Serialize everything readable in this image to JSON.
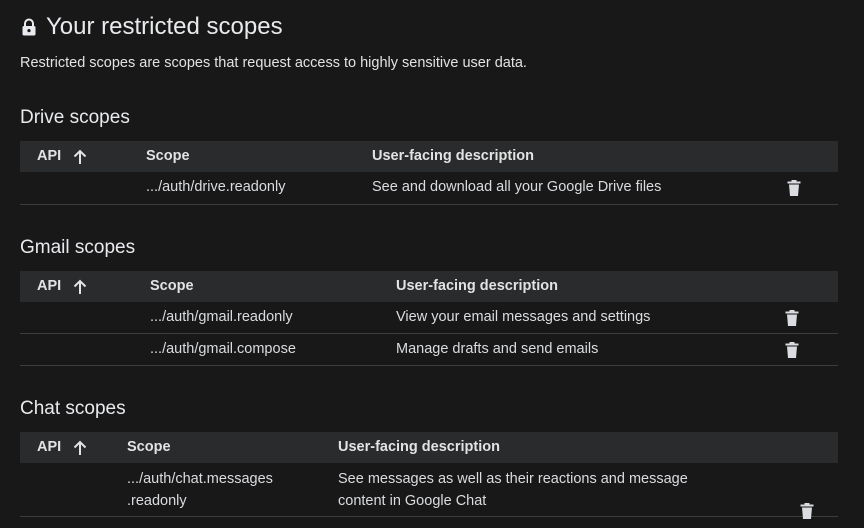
{
  "page": {
    "title": "Your restricted scopes",
    "subtitle": "Restricted scopes are scopes that request access to highly sensitive user data."
  },
  "columns": {
    "api": "API",
    "scope": "Scope",
    "description": "User-facing description"
  },
  "sections": [
    {
      "title": "Drive scopes",
      "rows": [
        {
          "scope": ".../auth/drive.readonly",
          "description": "See and download all your Google Drive files"
        }
      ]
    },
    {
      "title": "Gmail scopes",
      "rows": [
        {
          "scope": ".../auth/gmail.readonly",
          "description": "View your email messages and settings"
        },
        {
          "scope": ".../auth/gmail.compose",
          "description": "Manage drafts and send emails"
        }
      ]
    },
    {
      "title": "Chat scopes",
      "rows": [
        {
          "scope_line1": ".../auth/chat.messages",
          "scope_line2": ".readonly",
          "description_line1": "See messages as well as their reactions and message",
          "description_line2": "content in Google Chat"
        }
      ]
    }
  ],
  "icons": {
    "lock": "lock-icon",
    "sort": "arrow-up-icon",
    "delete": "trash-icon"
  },
  "colors": {
    "background": "#181818",
    "header_row": "#2a2b2d",
    "divider": "#3c3d3f",
    "text": "#e3e3e3"
  }
}
